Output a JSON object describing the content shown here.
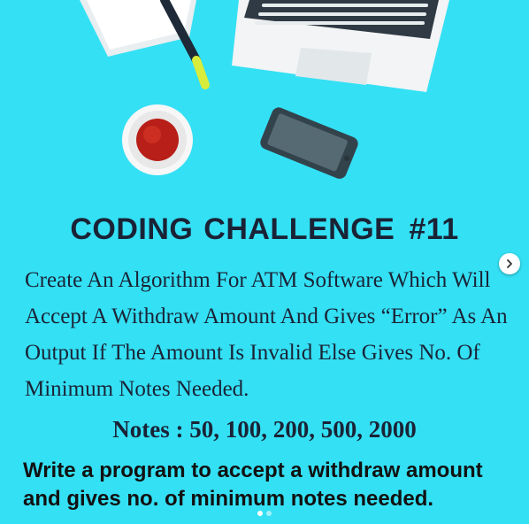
{
  "colors": {
    "background": "#34e0f4",
    "text": "#1a2336",
    "laptop": "#f2f4f5",
    "coffee": "#c0231c",
    "pencil": "#1e2a38",
    "phone": "#3a4b55"
  },
  "post": {
    "title": "CODING CHALLENGE",
    "number": "#11",
    "description_lines": [
      "Create An Algorithm For ATM Software Which Will",
      "Accept A Withdraw Amount And Gives “Error” As An",
      "Output If The Amount Is Invalid Else Gives No. Of",
      "Minimum Notes Needed."
    ],
    "notes": "Notes : 50, 100, 200, 500, 2000",
    "task_lines": [
      "Write a program to accept a withdraw amount",
      "and gives no. of minimum notes needed."
    ]
  },
  "carousel": {
    "next_icon": "chevron-right-icon",
    "slide_count": 2,
    "active_slide": 1
  },
  "illustration": {
    "items": [
      "paper-stack-icon",
      "pencil-icon",
      "laptop-icon",
      "coffee-cup-icon",
      "smartphone-icon"
    ]
  }
}
